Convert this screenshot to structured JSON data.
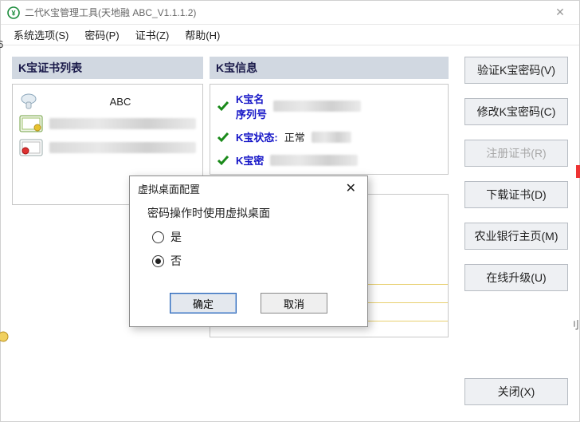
{
  "window": {
    "title": "二代K宝管理工具(天地融 ABC_V1.1.1.2)"
  },
  "menubar": {
    "items": [
      "系统选项(S)",
      "密码(P)",
      "证书(Z)",
      "帮助(H)"
    ],
    "left_fragment": "6"
  },
  "left_panel": {
    "header": "K宝证书列表",
    "device_label": "ABC"
  },
  "info_panel": {
    "header": "K宝信息",
    "rows": [
      {
        "label": "K宝名",
        "value": ""
      },
      {
        "label": "序列号",
        "value": ""
      },
      {
        "label": "K宝状态:",
        "value": "正常"
      },
      {
        "label": "K宝密",
        "value": ""
      }
    ]
  },
  "side_buttons": [
    {
      "label": "验证K宝密码(V)",
      "disabled": false
    },
    {
      "label": "修改K宝密码(C)",
      "disabled": false
    },
    {
      "label": "注册证书(R)",
      "disabled": true
    },
    {
      "label": "下载证书(D)",
      "disabled": false
    },
    {
      "label": "农业银行主页(M)",
      "disabled": false
    },
    {
      "label": "在线升级(U)",
      "disabled": false
    },
    {
      "label": "关闭(X)",
      "disabled": false
    }
  ],
  "dialog": {
    "title": "虚拟桌面配置",
    "prompt": "密码操作时使用虚拟桌面",
    "option_yes": "是",
    "option_no": "否",
    "selected": "no",
    "ok": "确定",
    "cancel": "取消"
  },
  "fragments": {
    "right_char": "刂"
  }
}
